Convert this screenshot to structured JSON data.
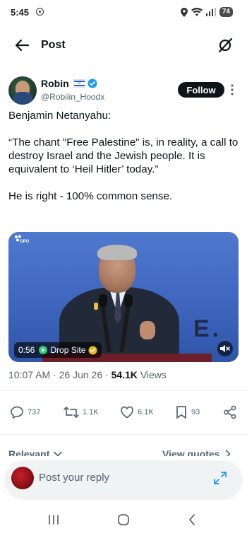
{
  "status_bar": {
    "time": "5:45",
    "battery": "74"
  },
  "header": {
    "title": "Post"
  },
  "author": {
    "name": "Robin",
    "handle": "@Robiiin_Hoodx",
    "follow_label": "Follow"
  },
  "tweet": {
    "paragraphs": [
      "Benjamin Netanyahu:",
      "“The chant \"Free Palestine\" is, in reality, a call to destroy Israel and the Jewish people. It is equivalent to ‘Heil Hitler’ today.”",
      "He is right - 100% common sense."
    ]
  },
  "video": {
    "logo_text": "GPO",
    "duration": "0:56",
    "source": "Drop Site",
    "backdrop_letters": "E."
  },
  "meta": {
    "time": "10:07 AM",
    "date": "26 Jun 26",
    "views_count": "54.1K",
    "views_label": "Views"
  },
  "actions": {
    "replies": "737",
    "reposts": "1.1K",
    "likes": "6.1K",
    "bookmarks": "93"
  },
  "replies_bar": {
    "sort_label": "Relevant",
    "view_quotes": "View quotes"
  },
  "composer": {
    "placeholder": "Post your reply"
  },
  "colors": {
    "accent": "#1d9bf0",
    "text": "#0f1419",
    "secondary": "#536471",
    "gold": "#e8b923"
  }
}
